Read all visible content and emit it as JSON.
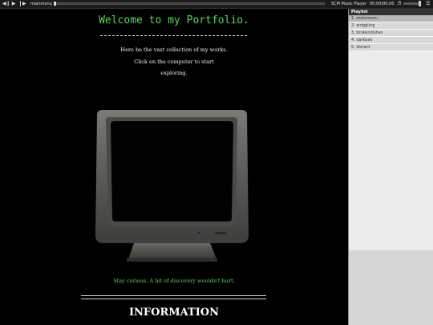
{
  "player": {
    "prev_icon": "previous-icon",
    "play_icon": "play-icon",
    "next_icon": "next-icon",
    "track": "mainmenu",
    "title": "SCM Music Player",
    "time": "00:00|00:00",
    "seek_progress": 0,
    "volume_icon": "volume-icon",
    "volume_level": 1.0,
    "playlist_toggle_icon": "playlist-toggle-icon"
  },
  "playlist": {
    "header": "Playlist",
    "items": [
      {
        "label": "1. mainmenu"
      },
      {
        "label": "2. wriggling"
      },
      {
        "label": "3. brokendishes"
      },
      {
        "label": "4. darkoak"
      },
      {
        "label": "5. distant"
      }
    ],
    "active_index": 0
  },
  "page": {
    "welcome": "Welcome to my Portfolio.",
    "intro_lines": [
      "Here be the vast collection of my works.",
      "Click on the computer to start",
      "exploring."
    ],
    "tagline": "Stay curious. A bit of discovery wouldn't hurt.",
    "info_heading": "INFORMATION"
  },
  "colors": {
    "accent_green": "#5fd25f",
    "background": "#000000"
  }
}
